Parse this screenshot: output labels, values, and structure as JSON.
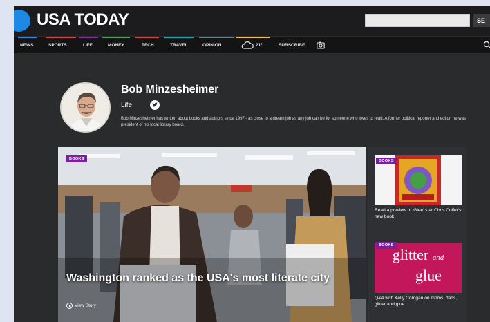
{
  "masthead": {
    "logo_text": "USA TODAY",
    "search_placeholder": "",
    "search_button": "SE"
  },
  "nav": {
    "items": [
      {
        "label": "NEWS",
        "color": "#1e88e5"
      },
      {
        "label": "SPORTS",
        "color": "#e53935"
      },
      {
        "label": "LIFE",
        "color": "#8e24aa"
      },
      {
        "label": "MONEY",
        "color": "#43a047"
      },
      {
        "label": "TECH",
        "color": "#e53935"
      },
      {
        "label": "TRAVEL",
        "color": "#00acc1"
      },
      {
        "label": "OPINION",
        "color": "#607d8b"
      }
    ],
    "weather_temp": "21°",
    "weather_color": "#fbc02d",
    "subscribe_label": "SUBSCRIBE",
    "icons": [
      "cloud-icon",
      "camera-icon",
      "search-icon"
    ]
  },
  "author": {
    "name": "Bob Minzesheimer",
    "section": "Life",
    "bio": "Bob Minzesheimer has written about books and authors since 1997 - as close to a dream job as any job can be for someone who loves to read. A former political reporter and editor, he was president of his local library board."
  },
  "feature": {
    "badge": "BOOKS",
    "headline": "Washington ranked as the USA's most literate city",
    "view_story": "View Story"
  },
  "side_stories": [
    {
      "badge": "BOOKS",
      "caption": "Read a preview of 'Glee' star Chris Colfer's new book"
    },
    {
      "badge": "BOOKS",
      "caption": "Q&A with Kelly Corrigan on moms, dads, glitter and glue",
      "art_text_1": "glitter",
      "art_text_2": "and",
      "art_text_3": "glue"
    }
  ],
  "colors": {
    "brand_blue": "#1e88e5",
    "badge_purple": "#7b1fa2",
    "page_bg": "#2a2b2d"
  }
}
